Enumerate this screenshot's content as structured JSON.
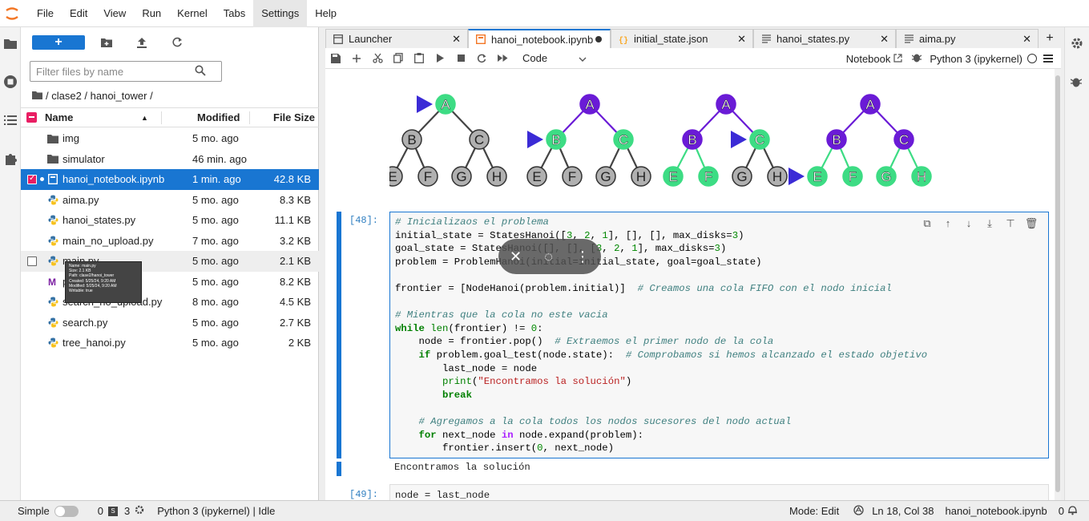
{
  "menu": [
    "File",
    "Edit",
    "View",
    "Run",
    "Kernel",
    "Tabs",
    "Settings",
    "Help"
  ],
  "menu_active": "Settings",
  "filebrowser": {
    "new_label": "+",
    "search_placeholder": "Filter files by name",
    "breadcrumb": "/ clase2 / hanoi_tower /",
    "columns": {
      "name": "Name",
      "modified": "Modified",
      "size": "File Size"
    },
    "files": [
      {
        "name": "img",
        "modified": "5 mo. ago",
        "size": "",
        "type": "folder"
      },
      {
        "name": "simulator",
        "modified": "46 min. ago",
        "size": "",
        "type": "folder"
      },
      {
        "name": "hanoi_notebook.ipynb",
        "modified": "1 min. ago",
        "size": "42.8 KB",
        "type": "notebook"
      },
      {
        "name": "aima.py",
        "modified": "5 mo. ago",
        "size": "8.3 KB",
        "type": "python"
      },
      {
        "name": "hanoi_states.py",
        "modified": "5 mo. ago",
        "size": "11.1 KB",
        "type": "python"
      },
      {
        "name": "main_no_upload.py",
        "modified": "7 mo. ago",
        "size": "3.2 KB",
        "type": "python"
      },
      {
        "name": "main.py",
        "modified": "5 mo. ago",
        "size": "2.1 KB",
        "type": "python"
      },
      {
        "name": "p",
        "modified": "5 mo. ago",
        "size": "8.2 KB",
        "type": "markdown"
      },
      {
        "name": "search_no_upload.py",
        "modified": "8 mo. ago",
        "size": "4.5 KB",
        "type": "python"
      },
      {
        "name": "search.py",
        "modified": "5 mo. ago",
        "size": "2.7 KB",
        "type": "python"
      },
      {
        "name": "tree_hanoi.py",
        "modified": "5 mo. ago",
        "size": "2 KB",
        "type": "python"
      }
    ],
    "tooltip": [
      "Name: main.py",
      "Size: 2.1 KB",
      "Path: clase2/hanoi_tower",
      "Created: 5/25/24, 9:20 AM",
      "Modified: 5/25/24, 9:20 AM",
      "Writable: true"
    ]
  },
  "tabs": [
    {
      "label": "Launcher",
      "icon": "launcher-icon"
    },
    {
      "label": "hanoi_notebook.ipynb",
      "icon": "notebook-icon",
      "active": true,
      "dirty": true
    },
    {
      "label": "initial_state.json",
      "icon": "json-icon"
    },
    {
      "label": "hanoi_states.py",
      "icon": "text-file-icon"
    },
    {
      "label": "aima.py",
      "icon": "text-file-icon"
    }
  ],
  "toolbar": {
    "cell_type": "Code",
    "notebook_link": "Notebook",
    "kernel": "Python 3 (ipykernel)"
  },
  "tree": {
    "nodes": [
      "A",
      "B",
      "C",
      "E",
      "F",
      "G",
      "H"
    ]
  },
  "cell": {
    "prompt": "[48]:",
    "output": "Encontramos la solución",
    "next_prompt": "[49]:",
    "next_code": "node = last_node"
  },
  "statusbar": {
    "mode_label": "Simple",
    "count1": "0",
    "count2": "3",
    "kernel_status": "Python 3 (ipykernel) | Idle",
    "mode": "Mode: Edit",
    "position": "Ln 18, Col 38",
    "filename": "hanoi_notebook.ipynb",
    "notif_count": "0"
  },
  "colors": {
    "accent": "#1976d2",
    "node_green": "#3ddc84",
    "node_purple": "#6a1bd6",
    "node_gray": "#b0b0b0",
    "marker": "#3b2bd6"
  }
}
